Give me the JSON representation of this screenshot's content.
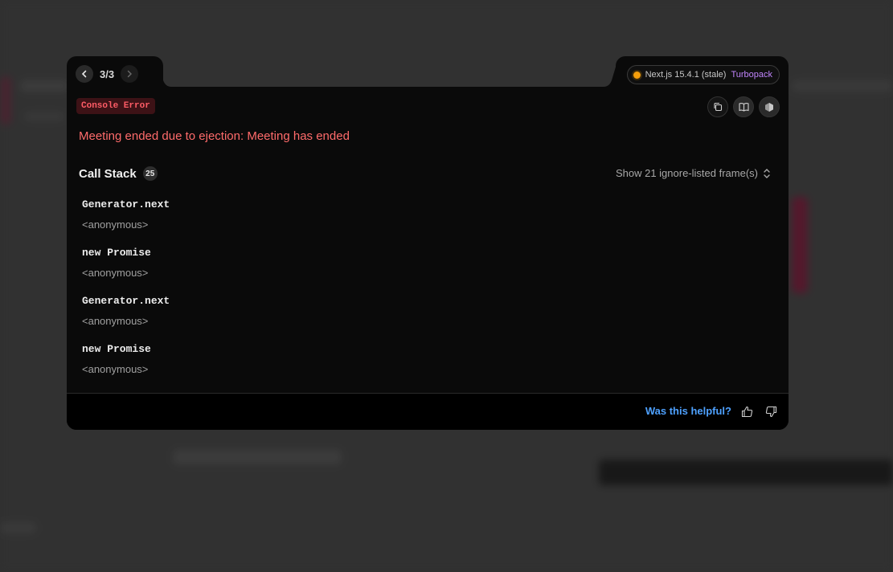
{
  "navigation": {
    "prev_icon": "chevron-left-icon",
    "next_icon": "chevron-right-icon",
    "counter": "3/3"
  },
  "version": {
    "indicator_color": "#f59e0b",
    "label": "Next.js 15.4.1 (stale)",
    "bundler": "Turbopack"
  },
  "error": {
    "badge": "Console Error",
    "message": "Meeting ended due to ejection: Meeting has ended"
  },
  "actions": {
    "copy_icon": "copy-icon",
    "docs_icon": "book-icon",
    "nodejs_icon": "nodejs-hexagon-icon"
  },
  "call_stack": {
    "title": "Call Stack",
    "count": "25",
    "ignore_toggle": "Show 21 ignore-listed frame(s)",
    "frames": [
      {
        "fn": "Generator.next",
        "loc": "<anonymous>"
      },
      {
        "fn": "new Promise",
        "loc": "<anonymous>"
      },
      {
        "fn": "Generator.next",
        "loc": "<anonymous>"
      },
      {
        "fn": "new Promise",
        "loc": "<anonymous>"
      }
    ]
  },
  "footer": {
    "helpful_text": "Was this helpful?",
    "thumbs_up_icon": "thumbs-up-icon",
    "thumbs_down_icon": "thumbs-down-icon"
  },
  "colors": {
    "error_red": "#ff6b6b",
    "link_blue": "#4ea1ff",
    "bundler_purple": "#c084fc"
  }
}
